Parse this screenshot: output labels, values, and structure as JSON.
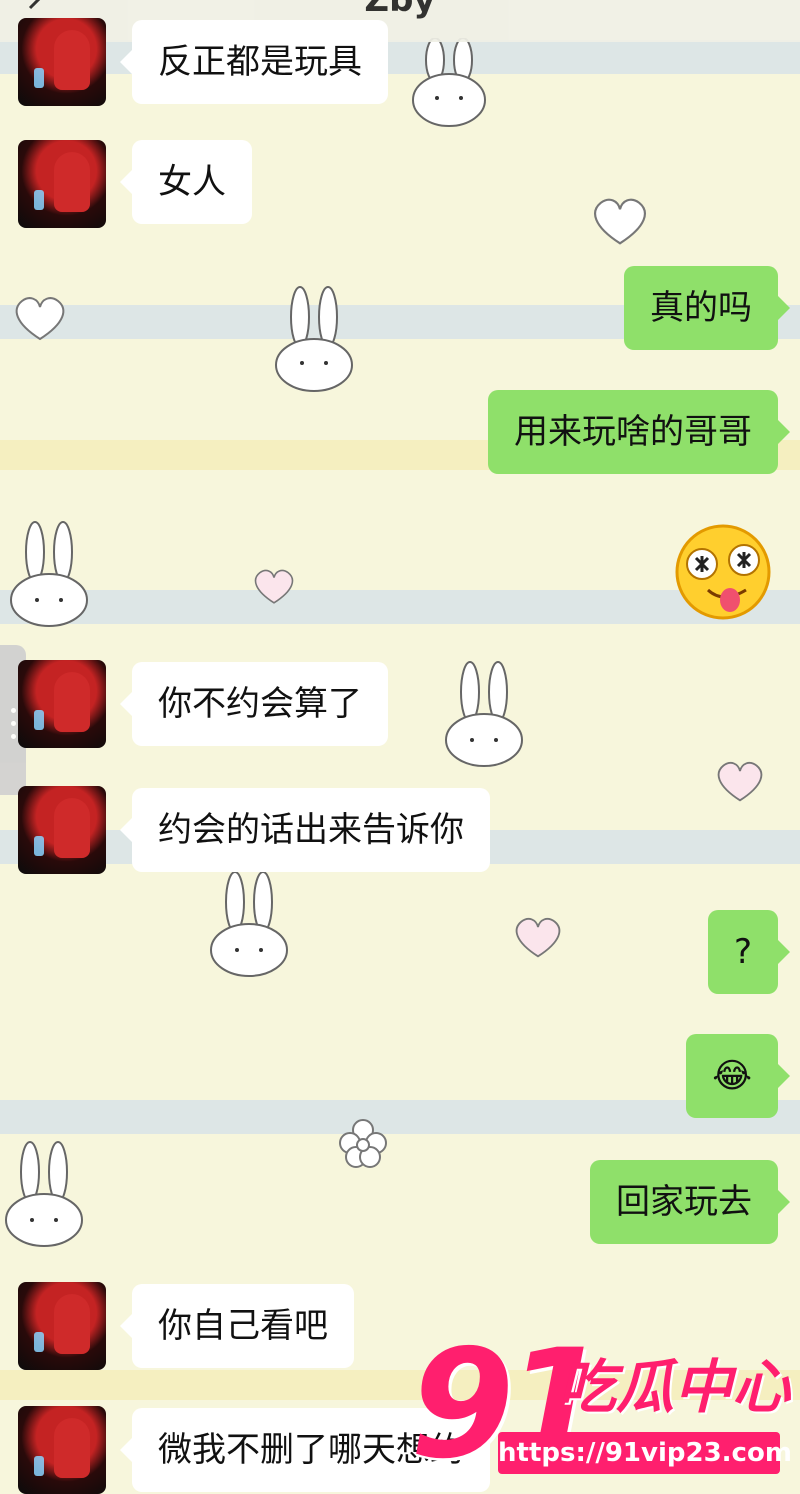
{
  "header": {
    "title": "Zby"
  },
  "messages": [
    {
      "side": "in",
      "text": "反正都是玩具"
    },
    {
      "side": "in",
      "text": "女人"
    },
    {
      "side": "out",
      "text": "真的吗"
    },
    {
      "side": "out",
      "text": "用来玩啥的哥哥"
    },
    {
      "side": "out",
      "sticker": "money-eyes-tongue-emoji"
    },
    {
      "side": "in",
      "text": "你不约会算了"
    },
    {
      "side": "in",
      "text": "约会的话出来告诉你"
    },
    {
      "side": "out",
      "text": "?"
    },
    {
      "side": "out",
      "text": "😂"
    },
    {
      "side": "out",
      "text": "回家玩去"
    },
    {
      "side": "in",
      "text": "你自己看吧"
    },
    {
      "side": "in",
      "text": "微我不删了哪天想约"
    }
  ],
  "watermark": {
    "number": "91",
    "name": "吃瓜中心",
    "url": "https://91vip23.com"
  },
  "colors": {
    "outgoing_bubble": "#8fe06a",
    "incoming_bubble": "#ffffff",
    "watermark": "#ff1f6e"
  }
}
